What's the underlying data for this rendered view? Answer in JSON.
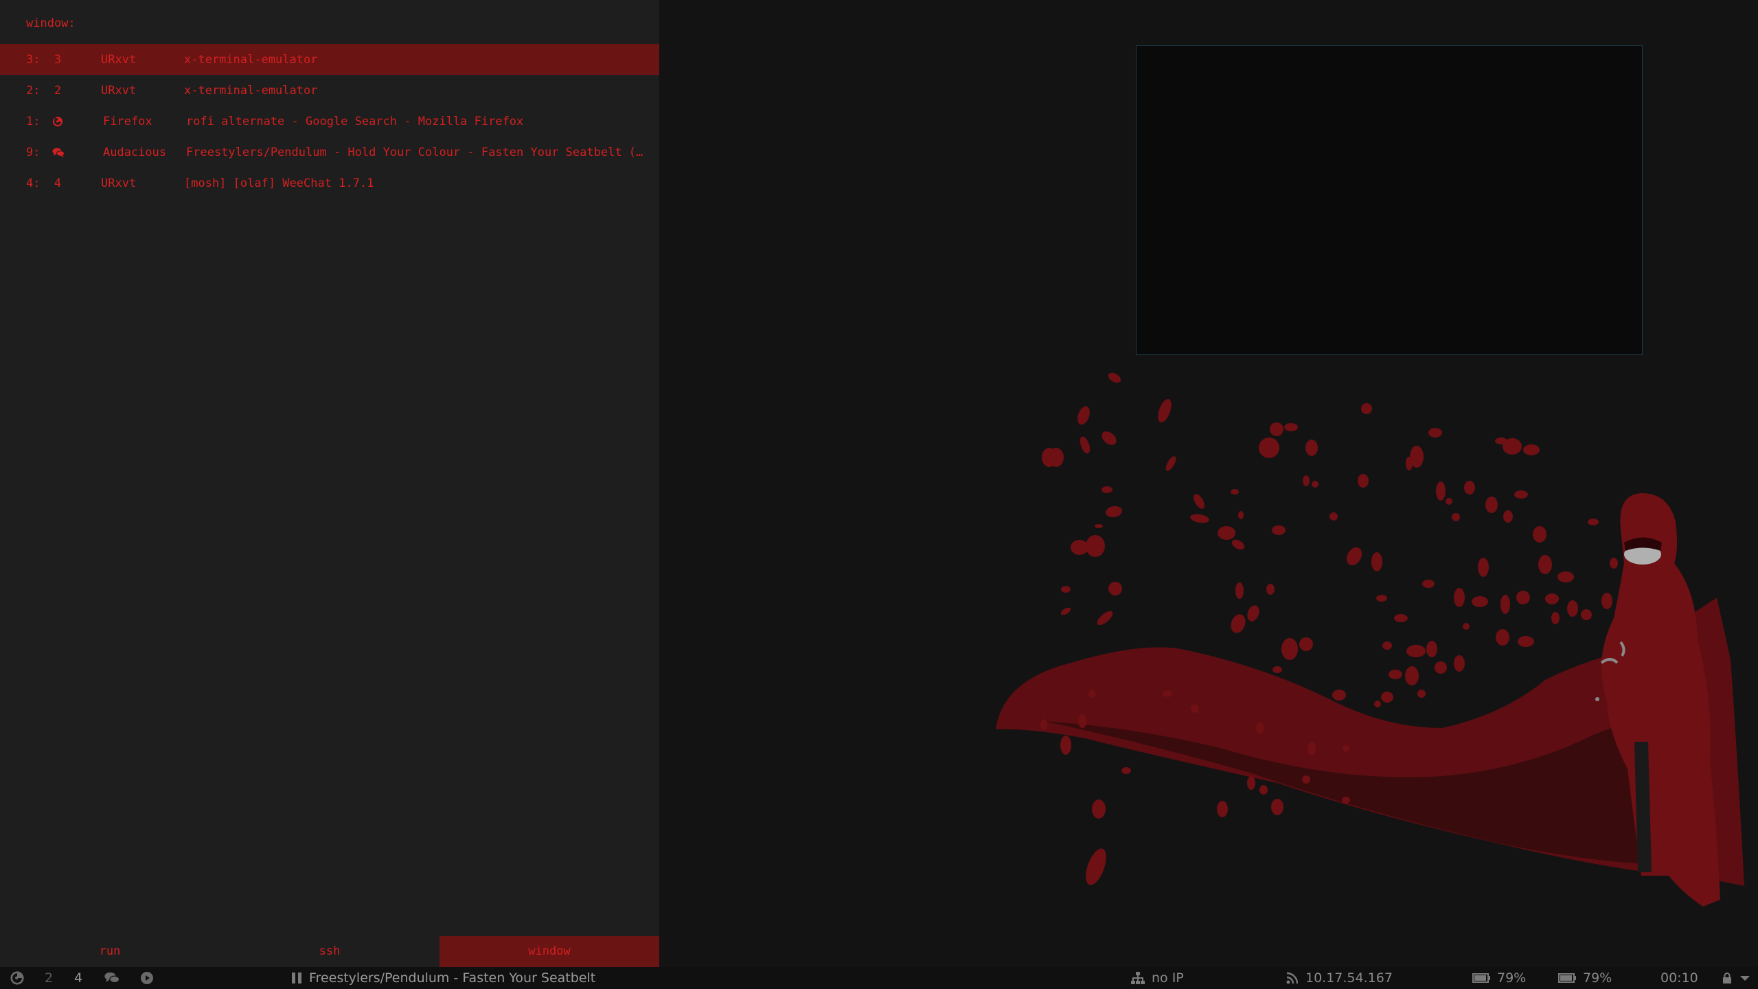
{
  "rofi": {
    "prompt": "window:",
    "rows": [
      {
        "num": "3:",
        "ws": "3",
        "icon": "",
        "cls": "URxvt",
        "title": "x-terminal-emulator",
        "selected": true
      },
      {
        "num": "2:",
        "ws": "2",
        "icon": "",
        "cls": "URxvt",
        "title": "x-terminal-emulator",
        "selected": false
      },
      {
        "num": "1:",
        "ws": "",
        "icon": "firefox-icon",
        "cls": "Firefox",
        "title": "rofi alternate - Google Search - Mozilla Firefox",
        "selected": false
      },
      {
        "num": "9:",
        "ws": "",
        "icon": "chat-icon",
        "cls": "Audacious",
        "title": "Freestylers/Pendulum - Hold Your Colour - Fasten Your Seatbelt (…",
        "selected": false
      },
      {
        "num": "4:",
        "ws": "4",
        "icon": "",
        "cls": "URxvt",
        "title": "[mosh] [olaf] WeeChat 1.7.1",
        "selected": false
      }
    ],
    "modes": [
      "run",
      "ssh",
      "window"
    ],
    "active_mode": "window"
  },
  "statusbar": {
    "workspaces": [
      "2",
      "4"
    ],
    "now_playing": "Freestylers/Pendulum - Fasten Your Seatbelt",
    "network_status": "no IP",
    "ip_address": "10.17.54.167",
    "battery_1": "79%",
    "battery_2": "79%",
    "clock": "00:10"
  },
  "colors": {
    "accent": "#d42020",
    "selection_bg": "#6a1414",
    "panel_bg": "#1e1e1e",
    "desktop_bg": "#131314",
    "wallpaper_red": "#6e1014"
  }
}
